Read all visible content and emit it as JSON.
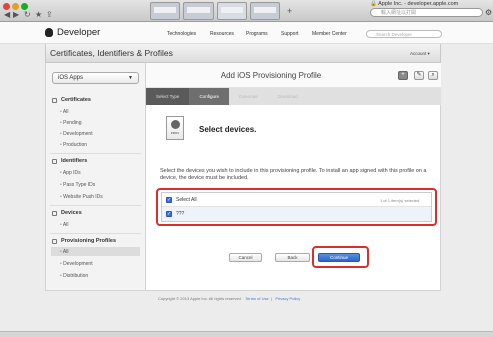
{
  "browser": {
    "address_domain": "Apple Inc.",
    "address_url": "developer.apple.com",
    "search_placeholder": "輸入網址以打開",
    "controls": [
      "◀",
      "▶",
      "↻",
      "★",
      "⇪"
    ]
  },
  "site": {
    "brand": "Developer",
    "nav": [
      "Technologies",
      "Resources",
      "Programs",
      "Support",
      "Member Center"
    ],
    "search_placeholder": "Search Developer"
  },
  "subheader": {
    "title": "Certificates, Identifiers & Profiles",
    "account": "Account ▾"
  },
  "sidebar": {
    "platform": "iOS Apps",
    "sections": [
      {
        "title": "Certificates",
        "items": [
          "All",
          "Pending",
          "Development",
          "Production"
        ]
      },
      {
        "title": "Identifiers",
        "items": [
          "App IDs",
          "Pass Type IDs",
          "Website Push IDs"
        ]
      },
      {
        "title": "Devices",
        "items": [
          "All"
        ]
      },
      {
        "title": "Provisioning Profiles",
        "items": [
          "All",
          "Development",
          "Distribution"
        ]
      }
    ],
    "selected": "Provisioning Profiles / All"
  },
  "main": {
    "title": "Add iOS Provisioning Profile",
    "icon_buttons": [
      "+",
      "✎",
      "⌕"
    ],
    "steps": [
      "Select Type",
      "Configure",
      "Generate",
      "Download"
    ],
    "current_step": "Configure",
    "package_label": "PROV",
    "heading": "Select devices.",
    "description": "Select the devices you wish to include in this provisioning profile. To install an app signed with this profile on a device, the device must be included.",
    "select_all_label": "Select All",
    "selected_count": "1 of 1 item(s) selected",
    "devices": [
      {
        "name": "???",
        "checked": true
      }
    ],
    "buttons": {
      "cancel": "Cancel",
      "back": "Back",
      "continue": "Continue"
    }
  },
  "footer": {
    "copyright": "Copyright © 2013 Apple Inc. All rights reserved.",
    "links": [
      "Terms of Use",
      "Privacy Policy"
    ]
  },
  "colors": {
    "highlight_red": "#d9302c",
    "primary_blue": "#2f66c7",
    "step_active": "#6f6f6f"
  }
}
